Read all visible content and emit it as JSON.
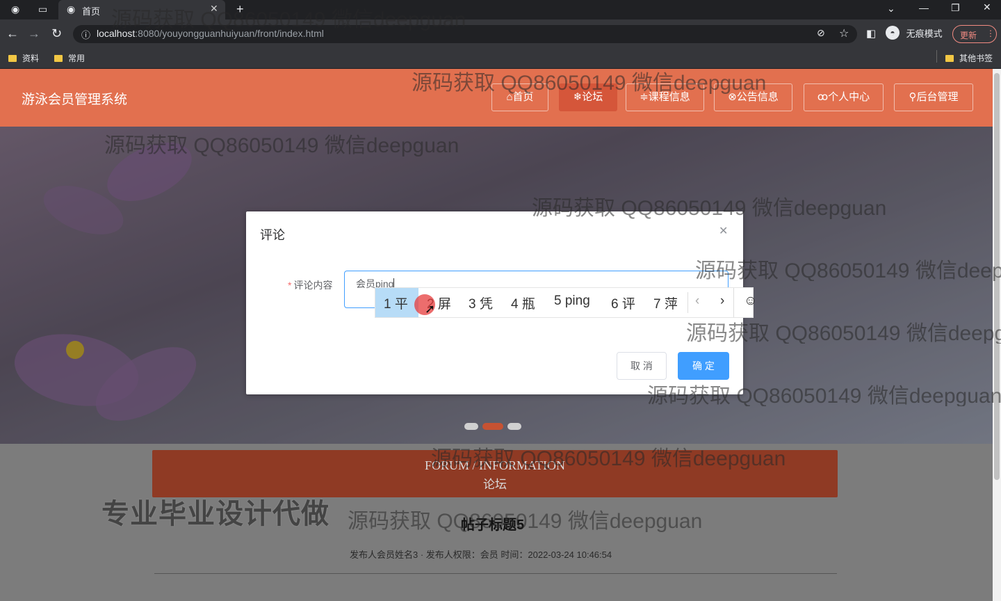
{
  "browser": {
    "tab_title": "首页",
    "url_host": "localhost",
    "url_path": ":8080/youyongguanhuiyuan/front/index.html",
    "incognito_label": "无痕模式",
    "update_label": "更新",
    "bookmarks": [
      "资料",
      "常用"
    ],
    "other_bookmarks": "其他书签"
  },
  "site": {
    "title": "游泳会员管理系统",
    "nav": [
      {
        "label": "首页",
        "icon": "⌂"
      },
      {
        "label": "论坛",
        "icon": "❄"
      },
      {
        "label": "课程信息",
        "icon": "≑"
      },
      {
        "label": "公告信息",
        "icon": "⊗"
      },
      {
        "label": "个人中心",
        "icon": "ꝏ"
      },
      {
        "label": "后台管理",
        "icon": "⚲"
      }
    ],
    "active_nav": "论坛"
  },
  "forum": {
    "heading_en": "FORUM / INFORMATION",
    "heading_cn": "论坛",
    "post_title": "帖子标题5",
    "post_meta": "发布人会员姓名3 · 发布人权限：会员   时间：2022-03-24 10:46:54"
  },
  "dialog": {
    "title": "评论",
    "field_label": "评论内容",
    "field_value": "会员ping",
    "cancel_label": "取 消",
    "confirm_label": "确 定"
  },
  "ime": {
    "candidates": [
      "1 平",
      "2 屏",
      "3 凭",
      "4 瓶",
      "5 ping",
      "6 评",
      "7 萍"
    ]
  },
  "watermarks": {
    "text": "源码获取 QQ86050149 微信deepguan",
    "promo": "专业毕业设计代做"
  },
  "colors": {
    "header": "#e2704f",
    "active_nav": "#d5563a",
    "primary_button": "#409eff"
  }
}
